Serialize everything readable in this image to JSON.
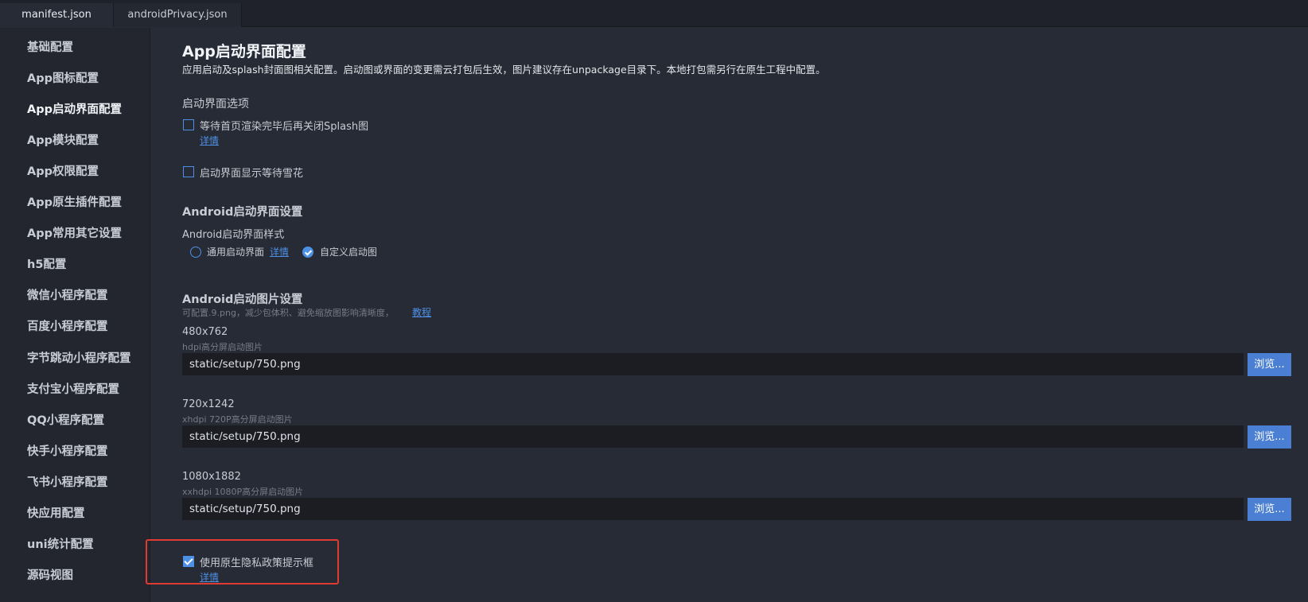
{
  "tabs": [
    {
      "label": "manifest.json",
      "active": true
    },
    {
      "label": "androidPrivacy.json",
      "active": false
    }
  ],
  "sidebar": {
    "items": [
      {
        "label": "基础配置"
      },
      {
        "label": "App图标配置"
      },
      {
        "label": "App启动界面配置",
        "active": true
      },
      {
        "label": "App模块配置"
      },
      {
        "label": "App权限配置"
      },
      {
        "label": "App原生插件配置"
      },
      {
        "label": "App常用其它设置"
      },
      {
        "label": "h5配置"
      },
      {
        "label": "微信小程序配置"
      },
      {
        "label": "百度小程序配置"
      },
      {
        "label": "字节跳动小程序配置"
      },
      {
        "label": "支付宝小程序配置"
      },
      {
        "label": "QQ小程序配置"
      },
      {
        "label": "快手小程序配置"
      },
      {
        "label": "飞书小程序配置"
      },
      {
        "label": "快应用配置"
      },
      {
        "label": "uni统计配置"
      },
      {
        "label": "源码视图"
      }
    ]
  },
  "main": {
    "title": "App启动界面配置",
    "description": "应用启动及splash封面图相关配置。启动图或界面的变更需云打包后生效，图片建议存在unpackage目录下。本地打包需另行在原生工程中配置。",
    "splash_options": {
      "heading": "启动界面选项",
      "wait_render": {
        "label": "等待首页渲染完毕后再关闭Splash图",
        "checked": false,
        "detail_link": "详情"
      },
      "show_snowflake": {
        "label": "启动界面显示等待雪花",
        "checked": false
      }
    },
    "android_splash": {
      "heading": "Android启动界面设置",
      "style_label": "Android启动界面样式",
      "options": [
        {
          "label": "通用启动界面",
          "checked": false,
          "detail_link": "详情"
        },
        {
          "label": "自定义启动图",
          "checked": true
        }
      ]
    },
    "android_images": {
      "heading": "Android启动图片设置",
      "hint": "可配置.9.png，减少包体积、避免缩放图影响清晰度，",
      "hint_link": "教程",
      "browse_label": "浏览...",
      "items": [
        {
          "size": "480x762",
          "desc": "hdpi高分屏启动图片",
          "value": "static/setup/750.png"
        },
        {
          "size": "720x1242",
          "desc": "xhdpi 720P高分屏启动图片",
          "value": "static/setup/750.png"
        },
        {
          "size": "1080x1882",
          "desc": "xxhdpi 1080P高分屏启动图片",
          "value": "static/setup/750.png"
        }
      ]
    },
    "privacy": {
      "label": "使用原生隐私政策提示框",
      "checked": true,
      "detail_link": "详情"
    }
  },
  "colors": {
    "accent": "#4e90e6",
    "highlight": "#e03a32",
    "browse": "#4a7fd4"
  }
}
